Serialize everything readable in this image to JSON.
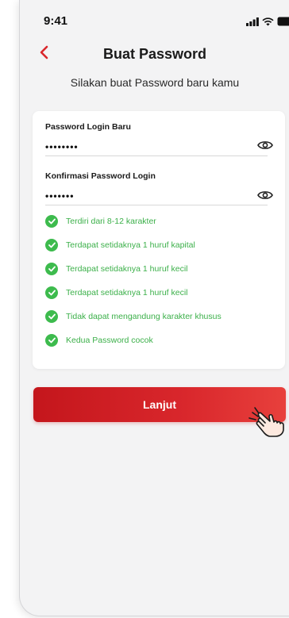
{
  "status_bar": {
    "time": "9:41",
    "signal_icon": "cellular-signal-icon",
    "wifi_icon": "wifi-icon",
    "battery_icon": "battery-icon"
  },
  "header": {
    "title": "Buat Password",
    "back_icon": "chevron-left-icon"
  },
  "subtitle": "Silakan buat Password baru kamu",
  "form": {
    "password_label": "Password Login Baru",
    "password_value": "••••••••",
    "confirm_label": "Konfirmasi Password Login",
    "confirm_value": "•••••••",
    "eye_icon": "eye-icon"
  },
  "rules": [
    {
      "text": "Terdiri dari 8-12 karakter",
      "status": "ok"
    },
    {
      "text": "Terdapat setidaknya 1 huruf kapital",
      "status": "ok"
    },
    {
      "text": "Terdapat setidaknya 1 huruf kecil",
      "status": "ok"
    },
    {
      "text": "Terdapat setidaknya 1 huruf kecil",
      "status": "ok"
    },
    {
      "text": "Tidak dapat mengandung karakter khusus",
      "status": "ok"
    },
    {
      "text": "Kedua Password cocok",
      "status": "ok"
    }
  ],
  "cta": {
    "label": "Lanjut"
  },
  "colors": {
    "accent": "#d9272c",
    "success": "#3dbb4d",
    "background": "#f3f3f4"
  }
}
